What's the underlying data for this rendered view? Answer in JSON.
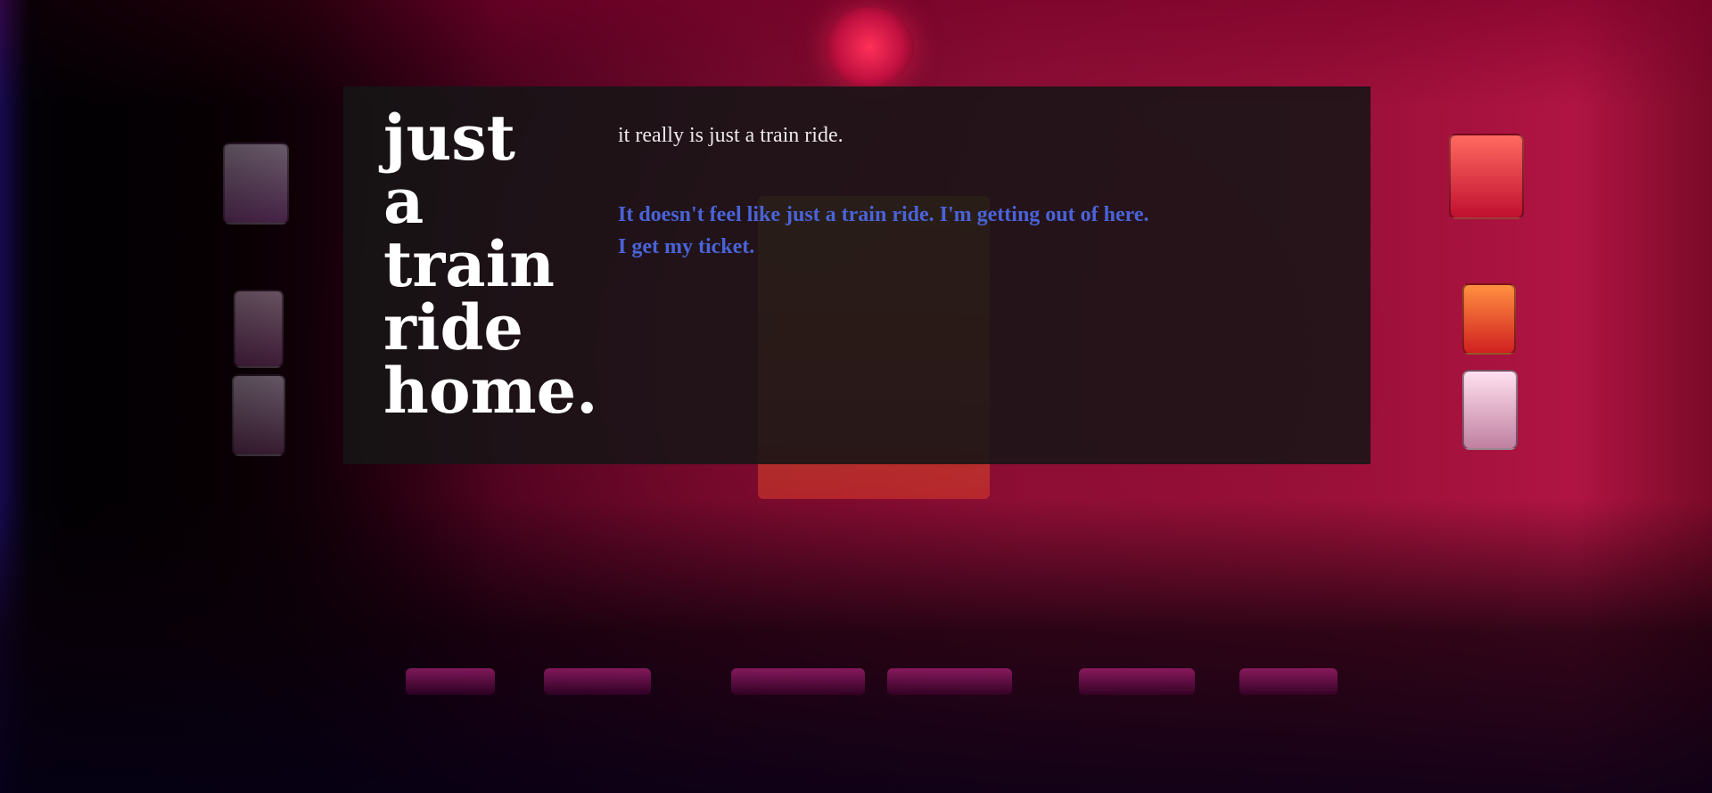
{
  "title": {
    "lines": [
      "just",
      "a",
      "train",
      "ride",
      "home."
    ]
  },
  "subtitle": "it really is just a train ride.",
  "story": {
    "lines": [
      "It doesn't feel like just a train ride. I'm getting out of here.",
      "I get my ticket."
    ]
  },
  "colors": {
    "title": "#ffffff",
    "subtitle": "#ece8ec",
    "story": "#4a63d8",
    "panel": "#161416"
  }
}
